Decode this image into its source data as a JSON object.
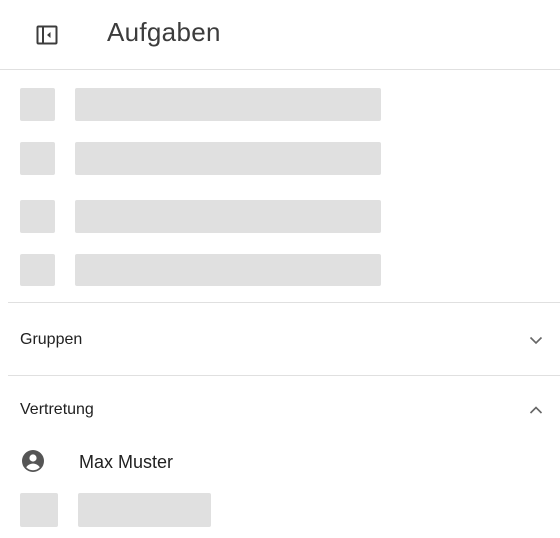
{
  "header": {
    "title": "Aufgaben",
    "toggle_icon": "sidebar-toggle-icon"
  },
  "skeleton_list": {
    "rows": 4
  },
  "groups_section": {
    "label": "Gruppen",
    "expanded": false,
    "icon": "chevron-down-icon"
  },
  "substitution_section": {
    "label": "Vertretung",
    "expanded": true,
    "icon": "chevron-up-icon",
    "people": [
      {
        "name": "Max Muster",
        "icon": "account-circle-icon"
      }
    ],
    "loading_rows": 1
  },
  "colors": {
    "skeleton": "#e0e0e0",
    "divider": "#e0e0e0",
    "icon": "#555555",
    "text": "#212121"
  }
}
